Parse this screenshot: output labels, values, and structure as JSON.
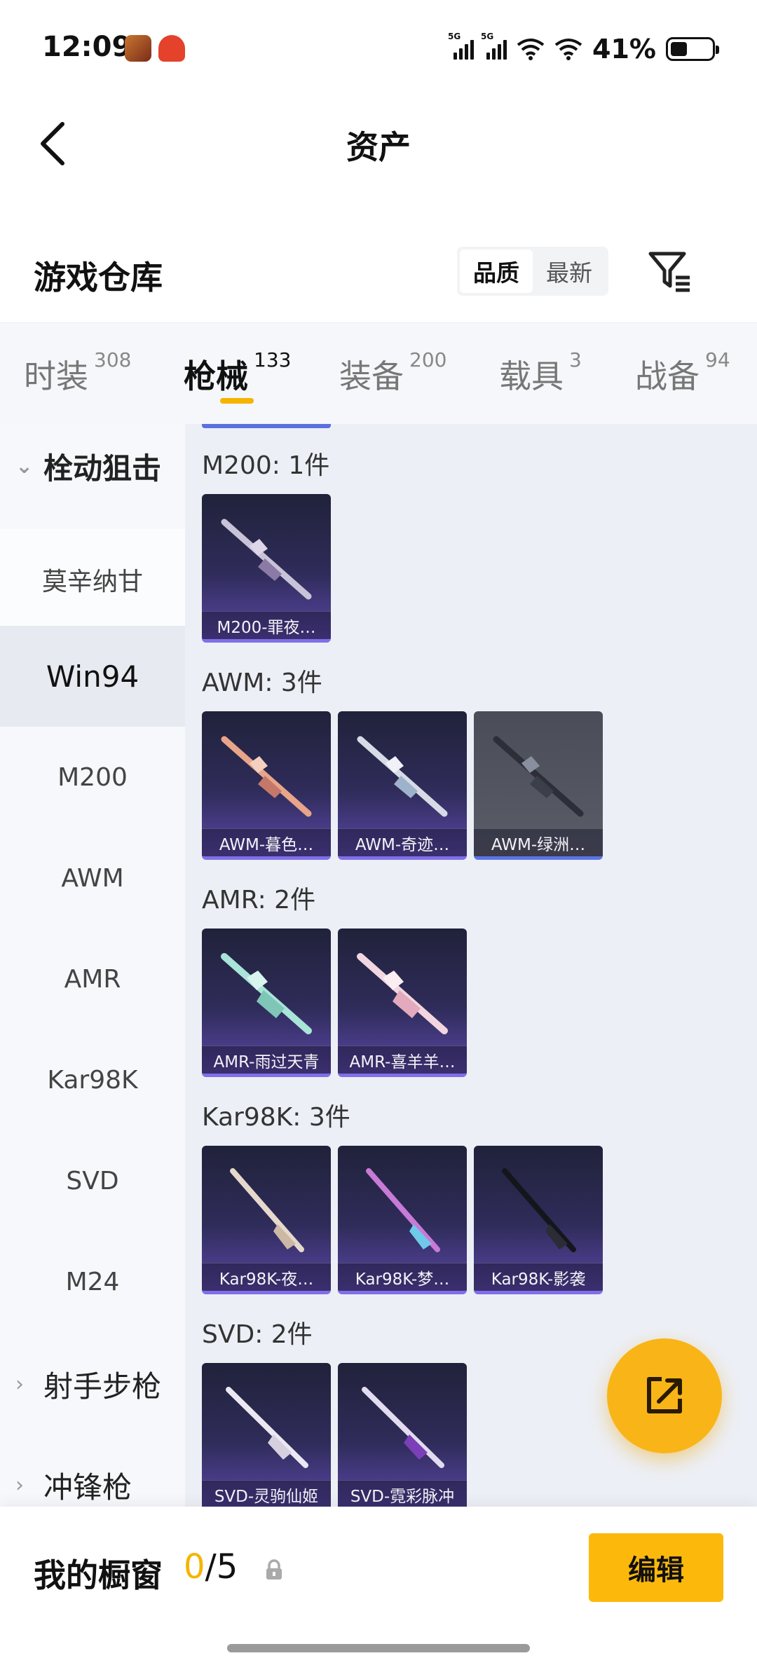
{
  "status_bar": {
    "time": "12:09",
    "network_1": "5G",
    "network_2": "5G",
    "battery": "41%",
    "battery_level": 0.41
  },
  "nav": {
    "title": "资产",
    "back_icon": "chevron-left-icon"
  },
  "warehouse": {
    "title": "游戏仓库",
    "sort_options": [
      "品质",
      "最新"
    ],
    "active_sort": "品质",
    "filter_icon": "filter-icon"
  },
  "tabs": [
    {
      "label": "时装",
      "count": "308"
    },
    {
      "label": "枪械",
      "count": "133"
    },
    {
      "label": "装备",
      "count": "200"
    },
    {
      "label": "载具",
      "count": "3"
    },
    {
      "label": "战备",
      "count": "94"
    }
  ],
  "active_tab": "枪械",
  "sidebar": {
    "group_open": "栓动狙击",
    "items": [
      "莫辛纳甘",
      "Win94",
      "M200",
      "AWM",
      "AMR",
      "Kar98K",
      "SVD",
      "M24"
    ],
    "active_item": "Win94",
    "group_2": "射手步枪",
    "group_3": "冲锋枪"
  },
  "groups": [
    {
      "title": "M200: 1件",
      "items": [
        "M200-罪夜…"
      ]
    },
    {
      "title": "AWM: 3件",
      "items": [
        "AWM-暮色…",
        "AWM-奇迹…",
        "AWM-绿洲…"
      ]
    },
    {
      "title": "AMR: 2件",
      "items": [
        "AMR-雨过天青",
        "AMR-喜羊羊…"
      ]
    },
    {
      "title": "Kar98K: 3件",
      "items": [
        "Kar98K-夜…",
        "Kar98K-梦…",
        "Kar98K-影袭"
      ]
    },
    {
      "title": "SVD: 2件",
      "items": [
        "SVD-灵驹仙姬",
        "SVD-霓彩脉冲"
      ]
    }
  ],
  "fab": {
    "icon": "share-icon"
  },
  "showcase": {
    "label": "我的橱窗",
    "current": "0",
    "total": "/5",
    "lock_icon": "lock-icon",
    "edit_label": "编辑"
  },
  "colors": {
    "accent": "#fdb90b",
    "card_border": "#7f6fe8",
    "highlight": "#5b6fe0"
  }
}
